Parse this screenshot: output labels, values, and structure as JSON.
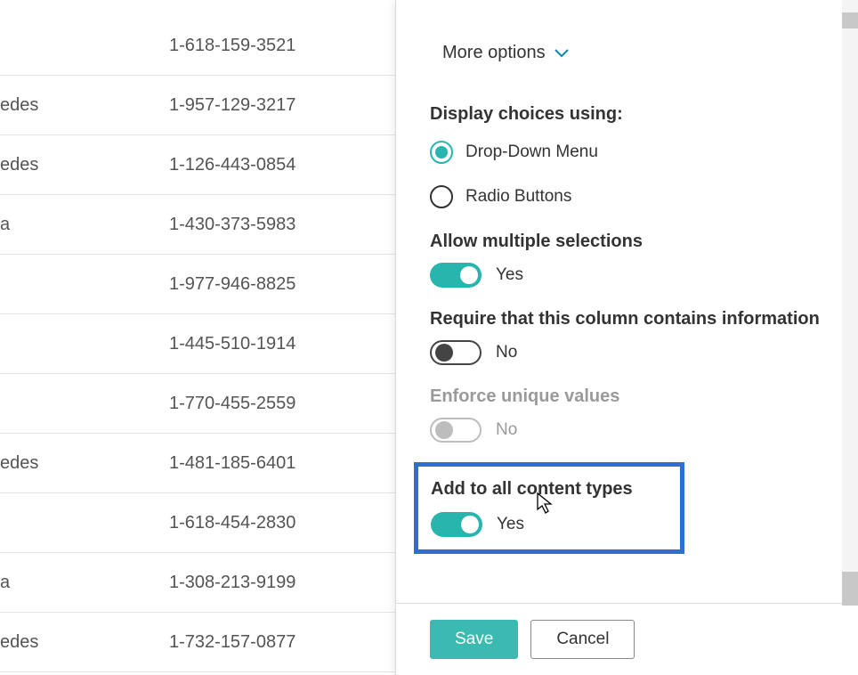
{
  "table": {
    "rows": [
      {
        "name": "",
        "phone": "1-618-159-3521"
      },
      {
        "name": "edes",
        "phone": "1-957-129-3217"
      },
      {
        "name": "edes",
        "phone": "1-126-443-0854"
      },
      {
        "name": "a",
        "phone": "1-430-373-5983"
      },
      {
        "name": "",
        "phone": "1-977-946-8825"
      },
      {
        "name": "",
        "phone": "1-445-510-1914"
      },
      {
        "name": "",
        "phone": "1-770-455-2559"
      },
      {
        "name": "edes",
        "phone": "1-481-185-6401"
      },
      {
        "name": "",
        "phone": "1-618-454-2830"
      },
      {
        "name": "a",
        "phone": "1-308-213-9199"
      },
      {
        "name": "edes",
        "phone": "1-732-157-0877"
      }
    ]
  },
  "pane": {
    "more_options": "More options",
    "display_choices_label": "Display choices using:",
    "radio": {
      "option1": "Drop-Down Menu",
      "option2": "Radio Buttons",
      "selected": "option1"
    },
    "allow_multiple": {
      "label": "Allow multiple selections",
      "state": "Yes",
      "on": true
    },
    "require_info": {
      "label": "Require that this column contains information",
      "state": "No",
      "on": false
    },
    "enforce_unique": {
      "label": "Enforce unique values",
      "state": "No",
      "disabled": true
    },
    "add_all_types": {
      "label": "Add to all content types",
      "state": "Yes",
      "on": true
    },
    "buttons": {
      "save": "Save",
      "cancel": "Cancel"
    }
  }
}
